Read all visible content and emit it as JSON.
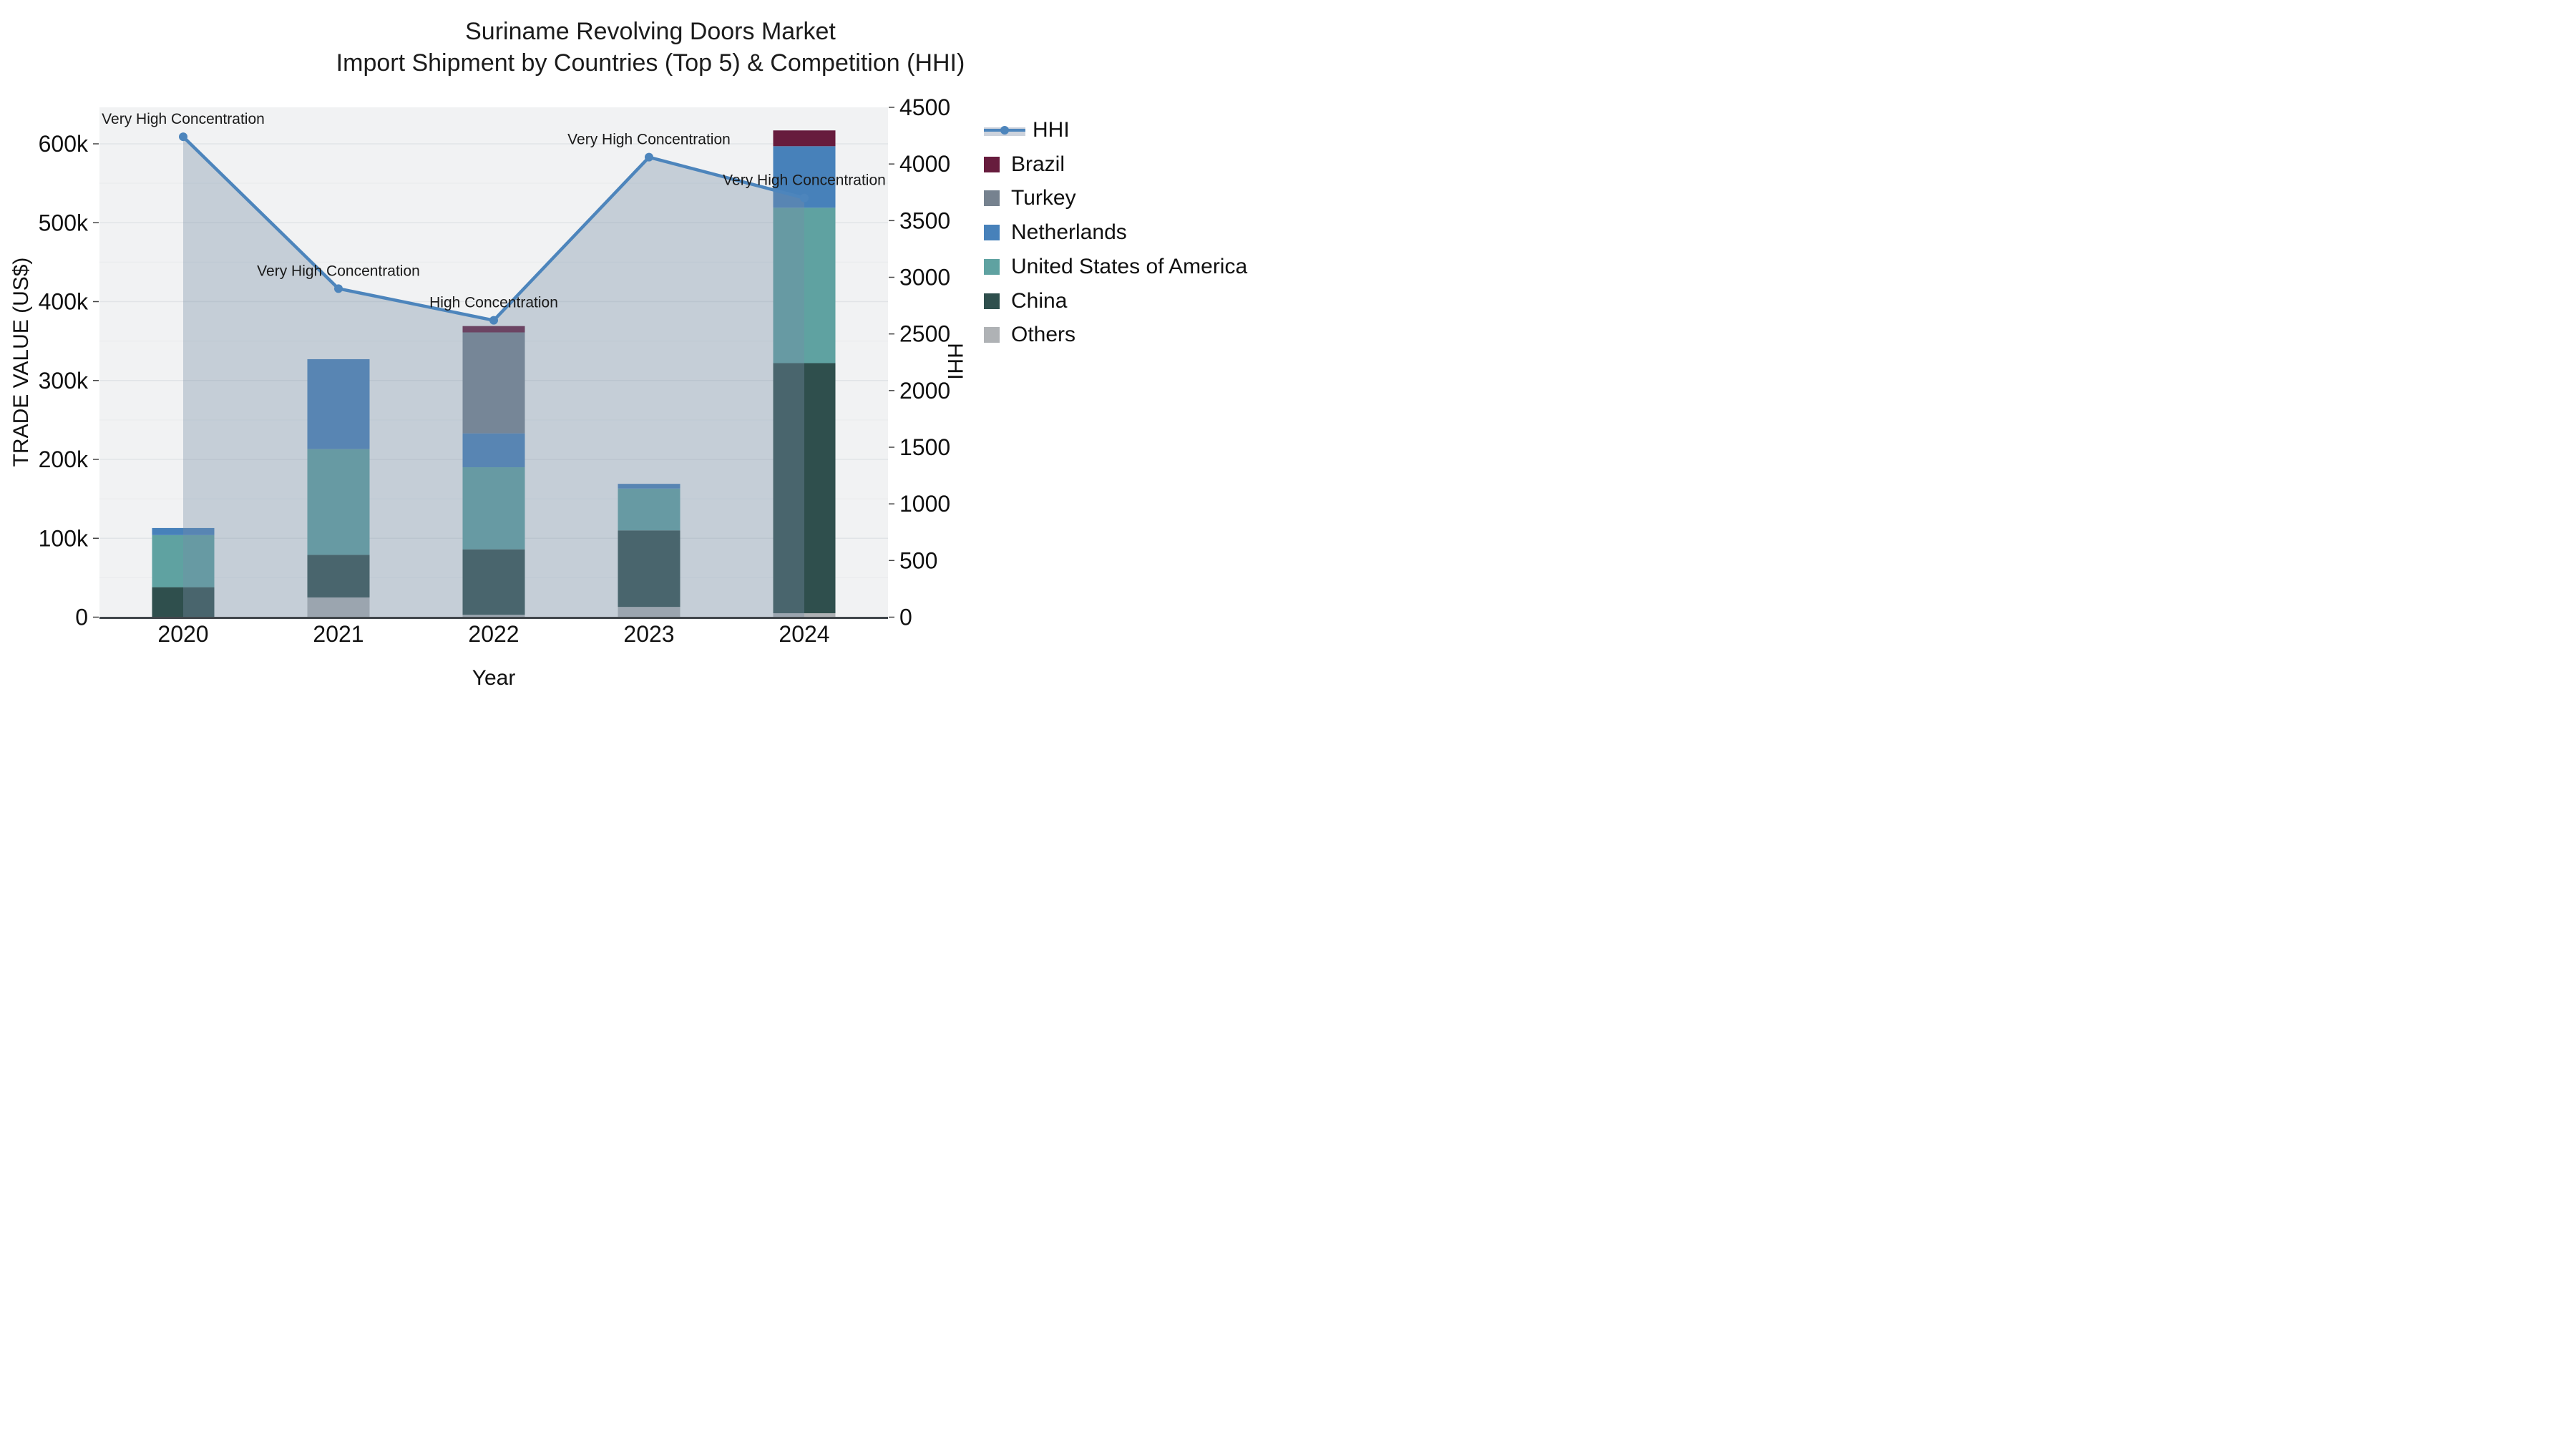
{
  "title": {
    "line1": "Suriname Revolving Doors Market",
    "line2": "Import Shipment by Countries (Top 5) & Competition (HHI)"
  },
  "chart_data": {
    "type": "combo: stacked-bar (left axis) + line with area fill (right axis)",
    "categories": [
      "2020",
      "2021",
      "2022",
      "2023",
      "2024"
    ],
    "bar_units": "thousand US$",
    "bar_series_bottom_to_top": [
      {
        "name": "Others",
        "color": "#afb2b5",
        "values_k": [
          0,
          25,
          3,
          13,
          5
        ]
      },
      {
        "name": "China",
        "color": "#2f4f4d",
        "values_k": [
          38,
          54,
          83,
          97,
          317
        ]
      },
      {
        "name": "United States of America",
        "color": "#5fa2a1",
        "values_k": [
          66,
          134,
          104,
          53,
          197
        ]
      },
      {
        "name": "Netherlands",
        "color": "#4781ba",
        "values_k": [
          9,
          114,
          43,
          6,
          78
        ]
      },
      {
        "name": "Turkey",
        "color": "#76828f",
        "values_k": [
          0,
          0,
          128,
          0,
          0
        ]
      },
      {
        "name": "Brazil",
        "color": "#671c3d",
        "values_k": [
          0,
          0,
          8,
          0,
          20
        ]
      }
    ],
    "bar_totals_k": [
      113,
      327,
      369,
      169,
      617
    ],
    "line_series": {
      "name": "HHI",
      "color": "#4d85bc",
      "area_fill": "rgba(120,140,165,0.36)",
      "values": [
        4240,
        2900,
        2620,
        4060,
        3700
      ]
    },
    "annotations": [
      {
        "x": "2020",
        "text": "Very High Concentration"
      },
      {
        "x": "2021",
        "text": "Very High Concentration"
      },
      {
        "x": "2022",
        "text": "High Concentration"
      },
      {
        "x": "2023",
        "text": "Very High Concentration"
      },
      {
        "x": "2024",
        "text": "Very High Concentration"
      }
    ],
    "x_axis": {
      "label": "Year"
    },
    "y1_axis": {
      "label": "TRADE VALUE (US$)",
      "tick_labels": [
        "0",
        "100k",
        "200k",
        "300k",
        "400k",
        "500k",
        "600k"
      ],
      "tick_values_k": [
        0,
        100,
        200,
        300,
        400,
        500,
        600
      ],
      "grid_minor_step_k": 50
    },
    "y2_axis": {
      "label": "HHI",
      "tick_labels": [
        "0",
        "500",
        "1000",
        "1500",
        "2000",
        "2500",
        "3000",
        "3500",
        "4000",
        "4500"
      ],
      "tick_values": [
        0,
        500,
        1000,
        1500,
        2000,
        2500,
        3000,
        3500,
        4000,
        4500
      ],
      "range": [
        0,
        4500
      ]
    },
    "legend_top_to_bottom": [
      {
        "label": "HHI",
        "type": "line"
      },
      {
        "label": "Brazil",
        "type": "swatch",
        "color": "#671c3d"
      },
      {
        "label": "Turkey",
        "type": "swatch",
        "color": "#76828f"
      },
      {
        "label": "Netherlands",
        "type": "swatch",
        "color": "#4781ba"
      },
      {
        "label": "United States of America",
        "type": "swatch",
        "color": "#5fa2a1"
      },
      {
        "label": "China",
        "type": "swatch",
        "color": "#2f4f4d"
      },
      {
        "label": "Others",
        "type": "swatch",
        "color": "#afb2b5"
      }
    ],
    "colors": {
      "plot_background": "#f1f2f3",
      "grid_major": "#e1e4e7",
      "grid_minor": "#eaecee",
      "axis_line": "#41464b",
      "text": "#111111"
    }
  }
}
